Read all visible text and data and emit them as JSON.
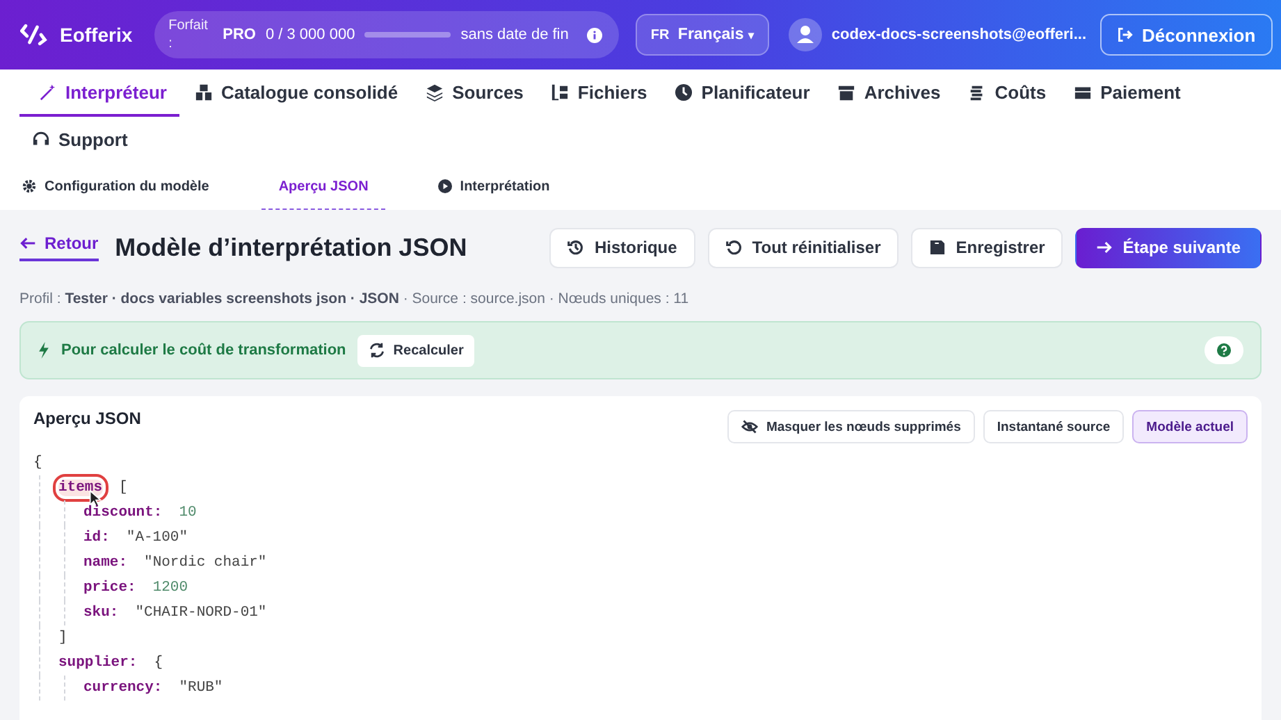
{
  "header": {
    "brand": "Eofferix",
    "plan": {
      "label": "Forfait :",
      "name": "PRO",
      "usage": "0 / 3 000 000",
      "level": 0,
      "expiry": "sans date de fin"
    },
    "language": {
      "code": "FR",
      "name": "Français",
      "caret": "▾"
    },
    "user": "codex-docs-screenshots@eofferi...",
    "logout": "Déconnexion"
  },
  "nav": [
    {
      "label": "Interpréteur",
      "selected": true
    },
    {
      "label": "Catalogue consolidé",
      "selected": false
    },
    {
      "label": "Sources",
      "selected": false
    },
    {
      "label": "Fichiers",
      "selected": false
    },
    {
      "label": "Planificateur",
      "selected": false
    },
    {
      "label": "Archives",
      "selected": false
    },
    {
      "label": "Coûts",
      "selected": false
    },
    {
      "label": "Paiement",
      "selected": false
    },
    {
      "label": "Support",
      "selected": false
    }
  ],
  "steps": [
    {
      "label": "Configuration du modèle",
      "selected": false
    },
    {
      "label": "Aperçu JSON",
      "selected": true
    },
    {
      "label": "Interprétation",
      "selected": false
    }
  ],
  "page": {
    "back": "Retour",
    "title": "Modèle d’interprétation JSON",
    "actions": [
      {
        "label": "Historique",
        "kind": "plain"
      },
      {
        "label": "Tout réinitialiser",
        "kind": "plain"
      },
      {
        "label": "Enregistrer",
        "kind": "plain"
      },
      {
        "label": "Étape suivante",
        "kind": "primary"
      }
    ],
    "profile": "Profil : **Tester · docs variables screenshots json · JSON** · Source : source.json · Nœuds uniques : 11"
  },
  "banner": {
    "text": "Pour calculer le coût de transformation",
    "button": "Recalculer"
  },
  "preview": {
    "title": "Aperçu JSON",
    "toggles": [
      {
        "label": "Masquer les nœuds supprimés",
        "selected": false
      },
      {
        "label": "Instantané source",
        "selected": false
      },
      {
        "label": "Modèle actuel",
        "selected": true
      }
    ],
    "tree": {
      "open": "{",
      "children": [
        {
          "key": "items",
          "open": "[",
          "highlighted": true,
          "close": "]",
          "children": [
            {
              "key": "discount:",
              "value": "10",
              "kind": "number"
            },
            {
              "key": "id:",
              "value": "\"A-100\"",
              "kind": "string"
            },
            {
              "key": "name:",
              "value": "\"Nordic chair\"",
              "kind": "string"
            },
            {
              "key": "price:",
              "value": "1200",
              "kind": "number"
            },
            {
              "key": "sku:",
              "value": "\"CHAIR-NORD-01\"",
              "kind": "string"
            }
          ]
        },
        {
          "key": "supplier:",
          "open": "{",
          "highlighted": false,
          "children": [
            {
              "key": "currency:",
              "value": "\"RUB\"",
              "kind": "string"
            }
          ]
        }
      ]
    }
  }
}
